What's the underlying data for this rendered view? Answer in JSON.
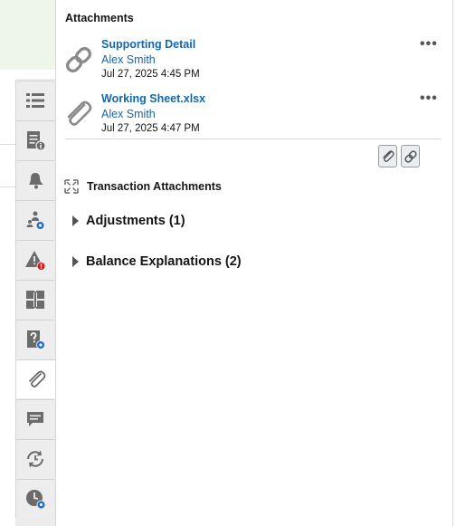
{
  "panel": {
    "title": "Attachments",
    "attachments": [
      {
        "name": "Supporting Detail",
        "user": "Alex Smith",
        "date": "Jul 27, 2025 4:45 PM",
        "type_icon": "link-icon"
      },
      {
        "name": "Working Sheet.xlsx",
        "user": "Alex Smith",
        "date": "Jul 27, 2025 4:47 PM",
        "type_icon": "paperclip-icon"
      }
    ],
    "more_label": "•••",
    "section_title": "Transaction Attachments",
    "groups": [
      {
        "label": "Adjustments (1)"
      },
      {
        "label": "Balance Explanations (2)"
      }
    ]
  },
  "colors": {
    "link": "#1268b1",
    "rail": "#ececec",
    "accent_badge": "#1d6dc9",
    "alert": "#d61a1a"
  }
}
